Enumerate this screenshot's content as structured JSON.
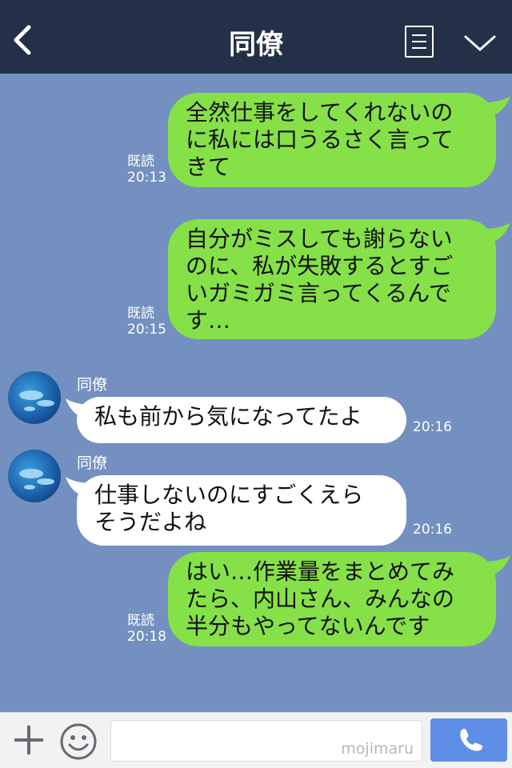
{
  "header": {
    "title": "同僚",
    "back_icon": "chevron-left-icon",
    "menu_icon": "menu-list-icon",
    "down_icon": "chevron-down-icon",
    "background": "#243047"
  },
  "chat": {
    "background": "#7390c0",
    "messages": [
      {
        "dir": "out",
        "text": "全然仕事をしてくれないの\nに私には口うるさく言って\nきて",
        "read": "既読",
        "time": "20:13"
      },
      {
        "dir": "out",
        "text": "自分がミスしても謝らない\nのに、私が失敗するとすご\nいガミガミ言ってくるんで\nす…",
        "read": "既読",
        "time": "20:15"
      },
      {
        "dir": "in",
        "sender": "同僚",
        "text": "私も前から気になってたよ",
        "time": "20:16"
      },
      {
        "dir": "in",
        "sender": "同僚",
        "text": "仕事しないのにすごくえら\nそうだよね",
        "time": "20:16"
      },
      {
        "dir": "out",
        "text": "はい…作業量をまとめてみ\nたら、内山さん、みんなの\n半分もやってないんです",
        "read": "既読",
        "time": "20:18"
      }
    ]
  },
  "footer": {
    "plus_icon": "plus-icon",
    "emoji_icon": "emoji-icon",
    "input_value": "",
    "watermark": "mojimaru",
    "call_icon": "phone-icon"
  },
  "colors": {
    "outgoing_bubble": "#86e048",
    "incoming_bubble": "#ffffff",
    "call_button": "#5f8ee6"
  }
}
